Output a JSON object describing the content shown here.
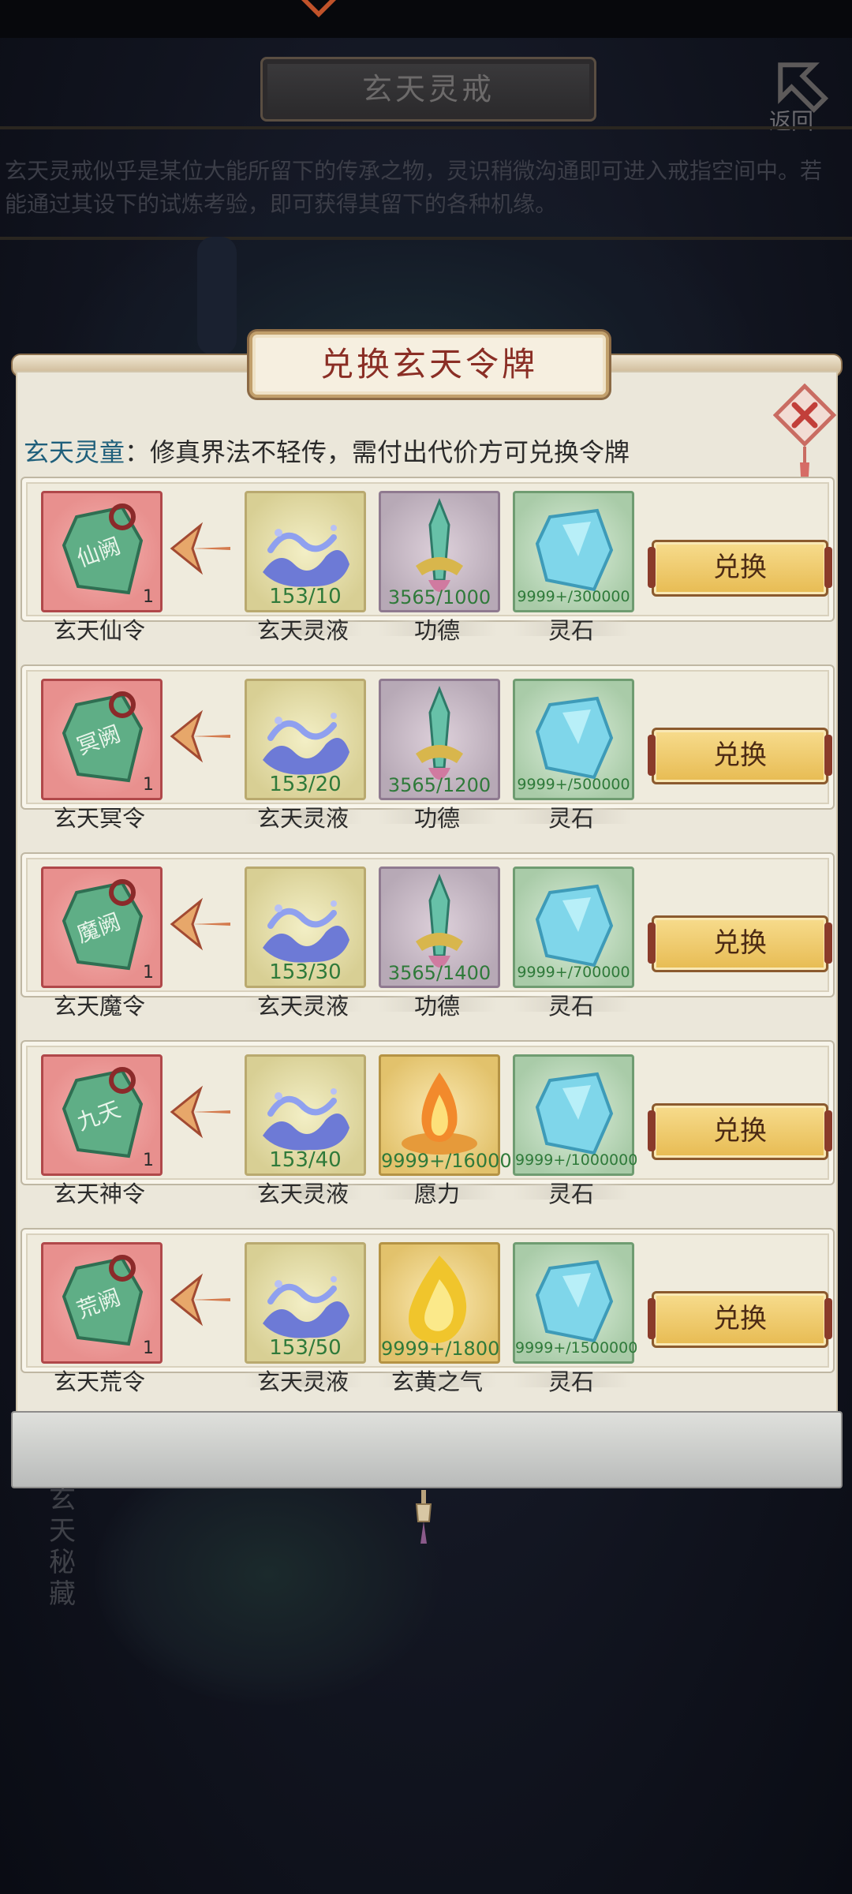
{
  "background": {
    "page_title": "玄天灵戒",
    "back_label": "返回",
    "description": "玄天灵戒似乎是某位大能所留下的传承之物，灵识稍微沟通即可进入戒指空间中。若能通过其设下的试炼考验，即可获得其留下的各种机缘。",
    "side_text": "玄天秘藏"
  },
  "dialog": {
    "title": "兑换玄天令牌",
    "narrator_name": "玄天灵童",
    "narrator_text": "：修真界法不轻传，需付出代价方可兑换令牌",
    "exchange_label": "兑换"
  },
  "rows": [
    {
      "token": {
        "name": "玄天仙令",
        "count": "1",
        "glyph": "仙阙"
      },
      "costs": [
        {
          "name": "玄天灵液",
          "req": "153/10",
          "color": "yellow",
          "icon": "liquid-icon"
        },
        {
          "name": "功德",
          "req": "3565/1000",
          "color": "purple",
          "icon": "merit-sword-icon"
        },
        {
          "name": "灵石",
          "req": "9999+/300000",
          "color": "green",
          "icon": "spirit-stone-icon"
        }
      ]
    },
    {
      "token": {
        "name": "玄天冥令",
        "count": "1",
        "glyph": "冥阙"
      },
      "costs": [
        {
          "name": "玄天灵液",
          "req": "153/20",
          "color": "yellow",
          "icon": "liquid-icon"
        },
        {
          "name": "功德",
          "req": "3565/1200",
          "color": "purple",
          "icon": "merit-sword-icon"
        },
        {
          "name": "灵石",
          "req": "9999+/500000",
          "color": "green",
          "icon": "spirit-stone-icon"
        }
      ]
    },
    {
      "token": {
        "name": "玄天魔令",
        "count": "1",
        "glyph": "魔阙"
      },
      "costs": [
        {
          "name": "玄天灵液",
          "req": "153/30",
          "color": "yellow",
          "icon": "liquid-icon"
        },
        {
          "name": "功德",
          "req": "3565/1400",
          "color": "purple",
          "icon": "merit-sword-icon"
        },
        {
          "name": "灵石",
          "req": "9999+/700000",
          "color": "green",
          "icon": "spirit-stone-icon"
        }
      ]
    },
    {
      "token": {
        "name": "玄天神令",
        "count": "1",
        "glyph": "九天"
      },
      "costs": [
        {
          "name": "玄天灵液",
          "req": "153/40",
          "color": "yellow",
          "icon": "liquid-icon"
        },
        {
          "name": "愿力",
          "req": "9999+/16000",
          "color": "orange",
          "icon": "wish-flame-icon"
        },
        {
          "name": "灵石",
          "req": "9999+/1000000",
          "color": "green",
          "icon": "spirit-stone-icon"
        }
      ]
    },
    {
      "token": {
        "name": "玄天荒令",
        "count": "1",
        "glyph": "荒阙"
      },
      "costs": [
        {
          "name": "玄天灵液",
          "req": "153/50",
          "color": "yellow",
          "icon": "liquid-icon"
        },
        {
          "name": "玄黄之气",
          "req": "9999+/1800",
          "color": "orange",
          "icon": "golden-qi-icon"
        },
        {
          "name": "灵石",
          "req": "9999+/1500000",
          "color": "green",
          "icon": "spirit-stone-icon"
        }
      ]
    }
  ],
  "colors": {
    "accent_title": "#8a2e25",
    "speaker": "#1f5f7b",
    "requirement": "#2f7a3a",
    "button": "#e7bb52"
  }
}
